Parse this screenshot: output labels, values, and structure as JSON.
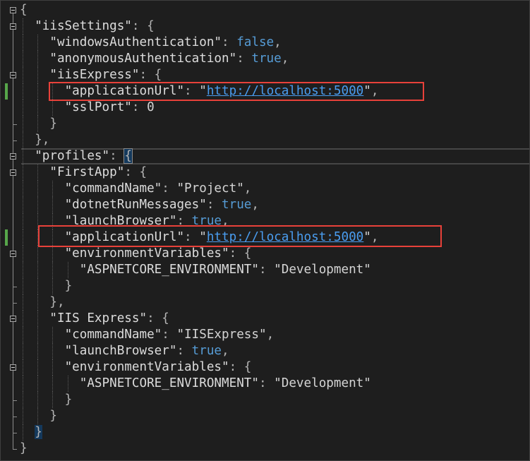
{
  "theme": {
    "background": "#1e1e1e",
    "key": "#dcdcdc",
    "string": "#d4d4d4",
    "punct": "#b4b4b4",
    "bool": "#569cd6",
    "number": "#d4d4d4",
    "url": "#4a9df0",
    "change_marker": "#57a64a",
    "annotation": "#e8413a",
    "outline": "#8c8c8c",
    "guide": "#5a5a5a",
    "current_line": "#464646",
    "brace_match": "#14395c"
  },
  "editor": {
    "lines": [
      {
        "indent": 0,
        "fold_start": true,
        "tokens": [
          {
            "punct": "{"
          }
        ]
      },
      {
        "indent": 1,
        "fold_start": true,
        "tokens": [
          {
            "key": "\"iisSettings\""
          },
          {
            "punct": ": {"
          }
        ]
      },
      {
        "indent": 2,
        "tokens": [
          {
            "key": "\"windowsAuthentication\""
          },
          {
            "punct": ": "
          },
          {
            "bool": "false"
          },
          {
            "punct": ","
          }
        ]
      },
      {
        "indent": 2,
        "tokens": [
          {
            "key": "\"anonymousAuthentication\""
          },
          {
            "punct": ": "
          },
          {
            "bool": "true"
          },
          {
            "punct": ","
          }
        ]
      },
      {
        "indent": 2,
        "fold_start": true,
        "tokens": [
          {
            "key": "\"iisExpress\""
          },
          {
            "punct": ": {"
          }
        ]
      },
      {
        "indent": 3,
        "changed": true,
        "tokens": [
          {
            "key": "\"applicationUrl\""
          },
          {
            "punct": ": "
          },
          {
            "string": "\""
          },
          {
            "url": "http://localhost:5000"
          },
          {
            "string": "\""
          },
          {
            "punct": ","
          }
        ]
      },
      {
        "indent": 3,
        "tokens": [
          {
            "key": "\"sslPort\""
          },
          {
            "punct": ": "
          },
          {
            "number": "0"
          }
        ]
      },
      {
        "indent": 2,
        "fold_end": true,
        "tokens": [
          {
            "punct": "}"
          }
        ]
      },
      {
        "indent": 1,
        "fold_end": true,
        "tokens": [
          {
            "punct": "},"
          }
        ]
      },
      {
        "indent": 1,
        "fold_start": true,
        "current": true,
        "tokens": [
          {
            "key": "\"profiles\""
          },
          {
            "punct": ": "
          },
          {
            "punct": "{",
            "match": true
          }
        ]
      },
      {
        "indent": 2,
        "fold_start": true,
        "tokens": [
          {
            "key": "\"FirstApp\""
          },
          {
            "punct": ": {"
          }
        ]
      },
      {
        "indent": 3,
        "tokens": [
          {
            "key": "\"commandName\""
          },
          {
            "punct": ": "
          },
          {
            "string": "\"Project\""
          },
          {
            "punct": ","
          }
        ]
      },
      {
        "indent": 3,
        "tokens": [
          {
            "key": "\"dotnetRunMessages\""
          },
          {
            "punct": ": "
          },
          {
            "bool": "true"
          },
          {
            "punct": ","
          }
        ]
      },
      {
        "indent": 3,
        "tokens": [
          {
            "key": "\"launchBrowser\""
          },
          {
            "punct": ": "
          },
          {
            "bool": "true"
          },
          {
            "punct": ","
          }
        ]
      },
      {
        "indent": 3,
        "changed": true,
        "tokens": [
          {
            "key": "\"applicationUrl\""
          },
          {
            "punct": ": "
          },
          {
            "string": "\""
          },
          {
            "url": "http://localhost:5000"
          },
          {
            "string": "\""
          },
          {
            "punct": ","
          }
        ]
      },
      {
        "indent": 3,
        "fold_start": true,
        "tokens": [
          {
            "key": "\"environmentVariables\""
          },
          {
            "punct": ": {"
          }
        ]
      },
      {
        "indent": 4,
        "tokens": [
          {
            "key": "\"ASPNETCORE_ENVIRONMENT\""
          },
          {
            "punct": ": "
          },
          {
            "string": "\"Development\""
          }
        ]
      },
      {
        "indent": 3,
        "fold_end": true,
        "tokens": [
          {
            "punct": "}"
          }
        ]
      },
      {
        "indent": 2,
        "fold_end": true,
        "tokens": [
          {
            "punct": "},"
          }
        ]
      },
      {
        "indent": 2,
        "fold_start": true,
        "tokens": [
          {
            "key": "\"IIS Express\""
          },
          {
            "punct": ": {"
          }
        ]
      },
      {
        "indent": 3,
        "tokens": [
          {
            "key": "\"commandName\""
          },
          {
            "punct": ": "
          },
          {
            "string": "\"IISExpress\""
          },
          {
            "punct": ","
          }
        ]
      },
      {
        "indent": 3,
        "tokens": [
          {
            "key": "\"launchBrowser\""
          },
          {
            "punct": ": "
          },
          {
            "bool": "true"
          },
          {
            "punct": ","
          }
        ]
      },
      {
        "indent": 3,
        "fold_start": true,
        "tokens": [
          {
            "key": "\"environmentVariables\""
          },
          {
            "punct": ": {"
          }
        ]
      },
      {
        "indent": 4,
        "tokens": [
          {
            "key": "\"ASPNETCORE_ENVIRONMENT\""
          },
          {
            "punct": ": "
          },
          {
            "string": "\"Development\""
          }
        ]
      },
      {
        "indent": 3,
        "fold_end": true,
        "tokens": [
          {
            "punct": "}"
          }
        ]
      },
      {
        "indent": 2,
        "fold_end": true,
        "tokens": [
          {
            "punct": "}"
          }
        ]
      },
      {
        "indent": 1,
        "fold_end": true,
        "tokens": [
          {
            "punct": "}",
            "match": true
          }
        ]
      },
      {
        "indent": 0,
        "fold_end": true,
        "tokens": [
          {
            "punct": "}"
          }
        ]
      }
    ]
  }
}
